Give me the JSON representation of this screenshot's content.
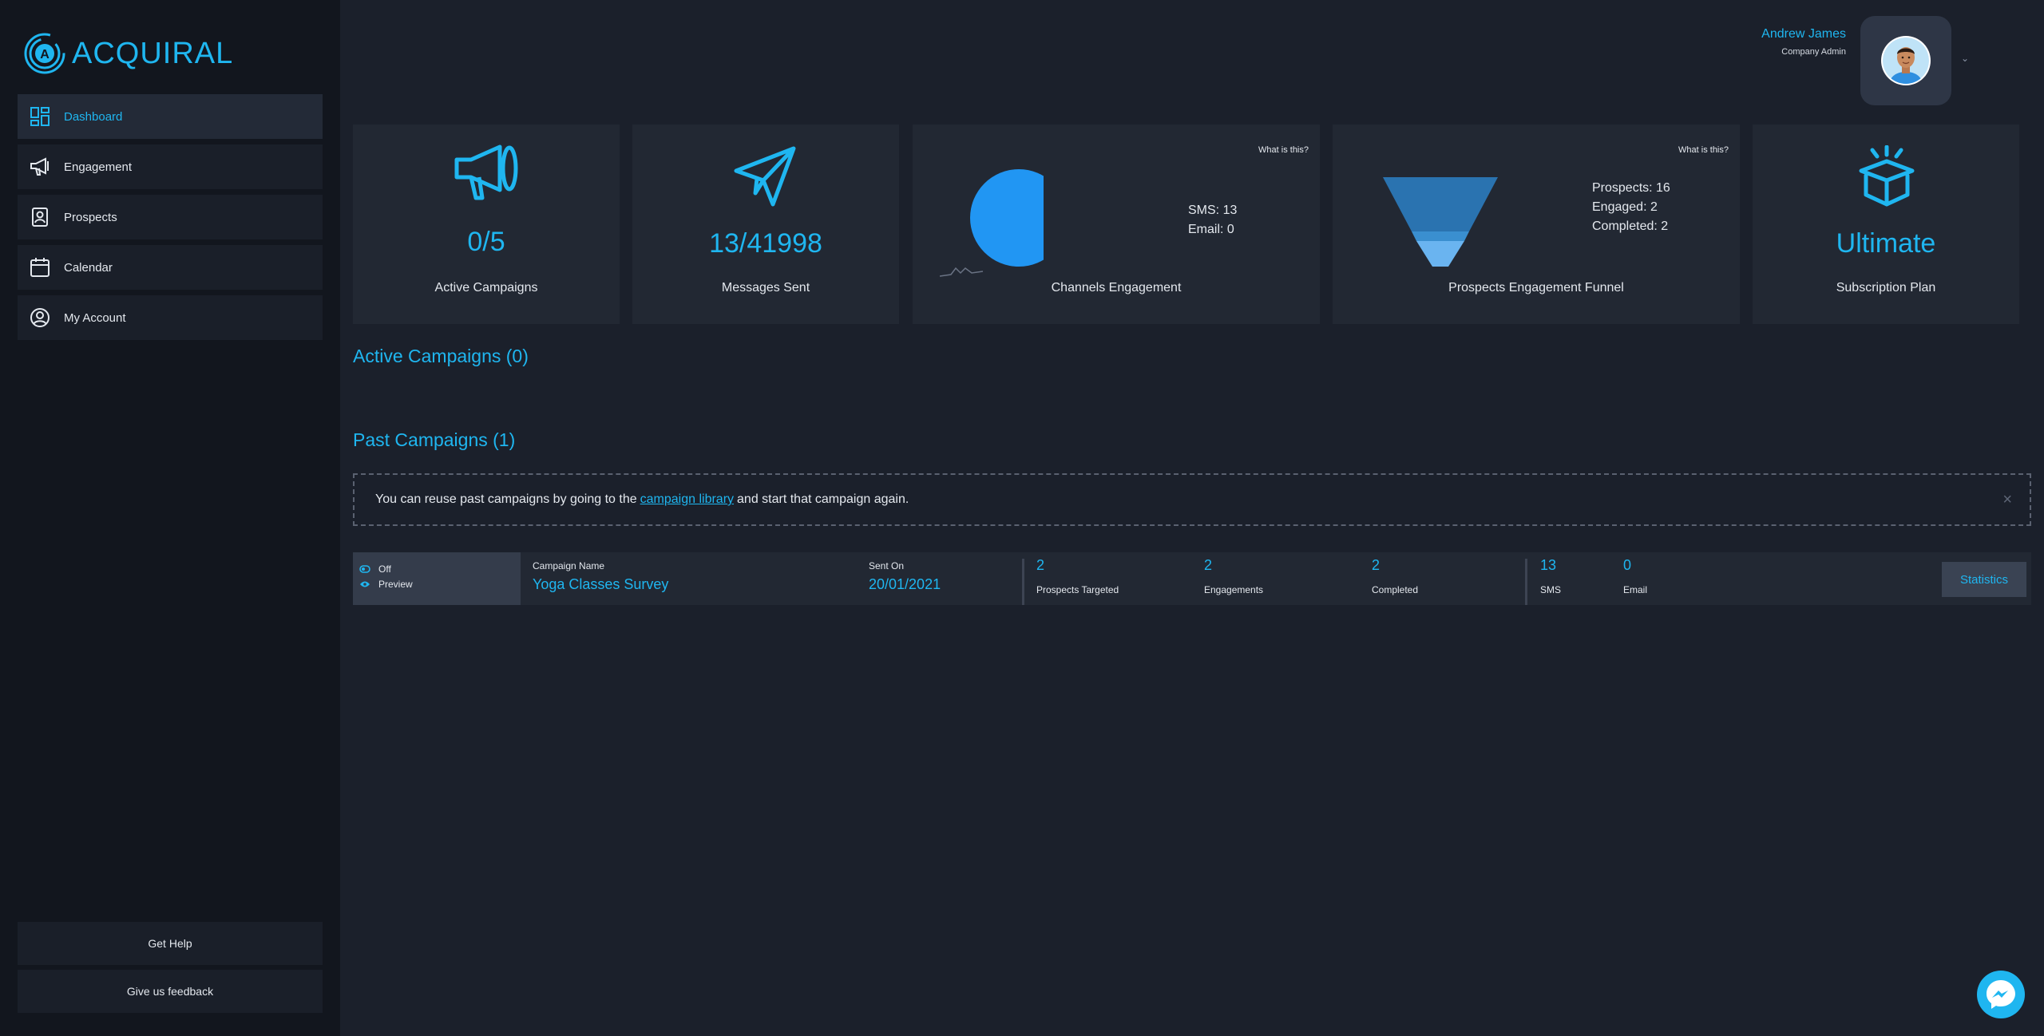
{
  "brand": {
    "name": "ACQUIRAL",
    "accent": "#1fb6f0"
  },
  "sidebar": {
    "items": [
      {
        "label": "Dashboard",
        "icon": "dashboard-icon",
        "active": true
      },
      {
        "label": "Engagement",
        "icon": "megaphone-icon"
      },
      {
        "label": "Prospects",
        "icon": "contacts-book-icon"
      },
      {
        "label": "Calendar",
        "icon": "calendar-icon"
      },
      {
        "label": "My Account",
        "icon": "user-circle-icon"
      }
    ],
    "help_label": "Get Help",
    "feedback_label": "Give us feedback"
  },
  "user": {
    "name": "Andrew James",
    "role": "Company Admin"
  },
  "cards": {
    "active_campaigns": {
      "value": "0/5",
      "label": "Active Campaigns"
    },
    "messages_sent": {
      "value": "13/41998",
      "label": "Messages Sent"
    },
    "channels": {
      "label": "Channels Engagement",
      "what": "What is this?",
      "sms": "SMS: 13",
      "email": "Email: 0"
    },
    "funnel": {
      "label": "Prospects Engagement Funnel",
      "what": "What is this?",
      "prospects": "Prospects: 16",
      "engaged": "Engaged: 2",
      "completed": "Completed: 2"
    },
    "subscription": {
      "value": "Ultimate",
      "label": "Subscription Plan"
    }
  },
  "chart_data": [
    {
      "type": "pie",
      "categories": [
        "SMS",
        "Email"
      ],
      "values": [
        13,
        0
      ]
    },
    {
      "type": "bar",
      "categories": [
        "Prospects",
        "Engaged",
        "Completed"
      ],
      "values": [
        16,
        2,
        2
      ]
    }
  ],
  "active_section": {
    "title": "Active Campaigns (0)"
  },
  "past_section": {
    "title": "Past Campaigns (1)"
  },
  "notice": {
    "before": "You can reuse past campaigns by going to the",
    "link": "campaign library",
    "after": "and start that campaign again.",
    "close": "×"
  },
  "campaign": {
    "toggle_label": "Off",
    "preview_label": "Preview",
    "name_label": "Campaign Name",
    "name": "Yoga Classes Survey",
    "sent_label": "Sent On",
    "sent": "20/01/2021",
    "prospects_targeted": "2",
    "prospects_targeted_label": "Prospects Targeted",
    "engagements": "2",
    "engagements_label": "Engagements",
    "completed": "2",
    "completed_label": "Completed",
    "sms": "13",
    "sms_label": "SMS",
    "email": "0",
    "email_label": "Email",
    "stats_button": "Statistics"
  }
}
